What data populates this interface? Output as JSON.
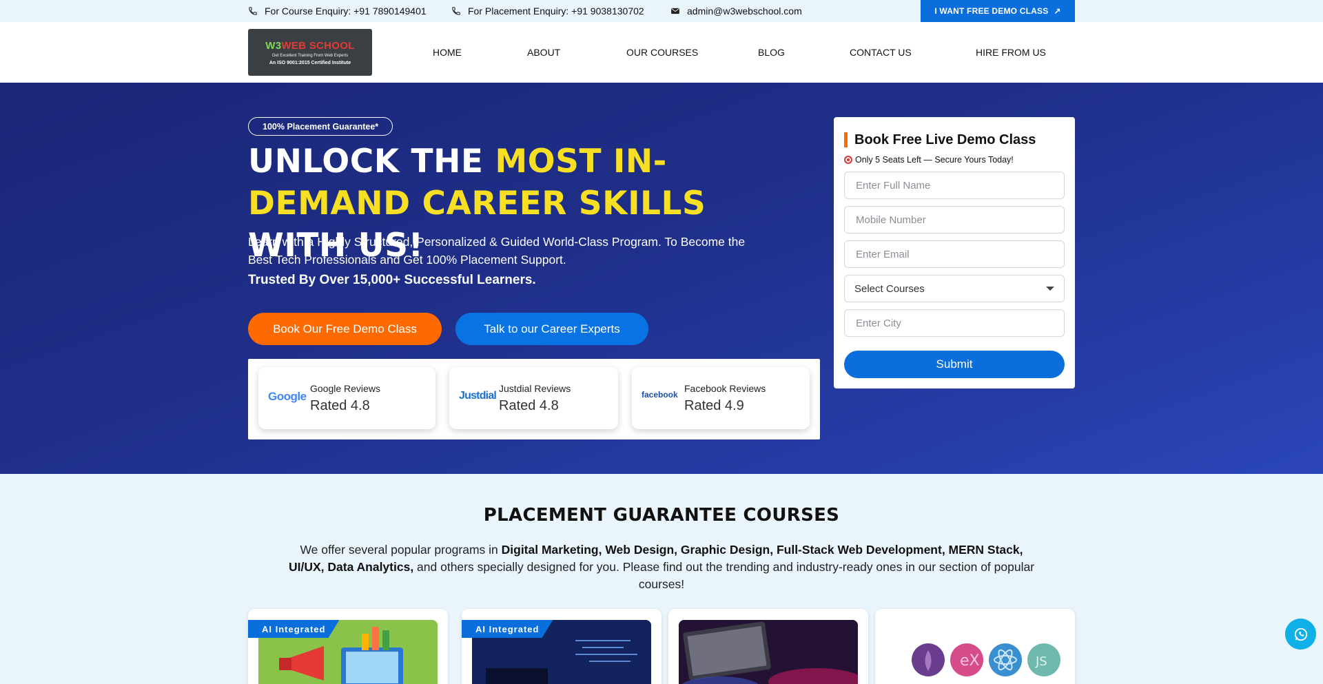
{
  "topbar": {
    "course_enquiry": "For Course Enquiry: +91 7890149401",
    "placement_enquiry": "For Placement Enquiry: +91 9038130702",
    "email": "admin@w3webschool.com",
    "demo_button": "I WANT FREE DEMO CLASS"
  },
  "logo": {
    "name_a": "W3",
    "name_b": "WEB SCHOOL",
    "tagline": "Get Excellent Training From Web Experts",
    "iso": "An ISO 9001:2015 Certified Institute"
  },
  "nav": {
    "items": [
      "HOME",
      "ABOUT",
      "OUR COURSES",
      "BLOG",
      "CONTACT US",
      "HIRE FROM US"
    ]
  },
  "hero": {
    "badge": "100% Placement Guarantee*",
    "title_a": "UNLOCK THE ",
    "title_highlight": "MOST IN-DEMAND CAREER SKILLS",
    "title_b": " WITH US!",
    "description": "Learn with a Highly Structured, Personalized & Guided World-Class Program. To Become the Best Tech Professionals and Get 100% Placement Support.",
    "trusted": "Trusted By Over 15,000+ Successful Learners.",
    "primary_button": "Book Our Free Demo Class",
    "secondary_button": "Talk to our Career Experts"
  },
  "reviews": [
    {
      "logo": "Google",
      "name": "Google Reviews",
      "rating": "Rated 4.8"
    },
    {
      "logo": "Justdial",
      "name": "Justdial Reviews",
      "rating": "Rated 4.8"
    },
    {
      "logo": "facebook",
      "name": "Facebook Reviews",
      "rating": "Rated 4.9"
    }
  ],
  "form": {
    "title": "Book Free Live Demo Class",
    "subtitle": "Only 5 Seats Left — Secure Yours Today!",
    "name_placeholder": "Enter Full Name",
    "mobile_placeholder": "Mobile Number",
    "email_placeholder": "Enter Email",
    "course_select": "Select Courses",
    "city_placeholder": "Enter City",
    "submit": "Submit"
  },
  "courses": {
    "title": "PLACEMENT GUARANTEE COURSES",
    "desc_a": "We offer several popular programs in ",
    "desc_bold_a": "Digital Marketing, Web Design, Graphic Design, Full-Stack Web Development, MERN Stack, UI/UX, Data Analytics,",
    "desc_b": " and others specially designed for you. Please find out the trending and industry-ready ones in our section of popular courses!",
    "ai_tag": "AI Integrated"
  },
  "colors": {
    "accent_blue": "#0a6fdc",
    "accent_orange": "#ff6a00",
    "hero_yellow": "#f7e024",
    "hero_navy": "#1a2677"
  }
}
